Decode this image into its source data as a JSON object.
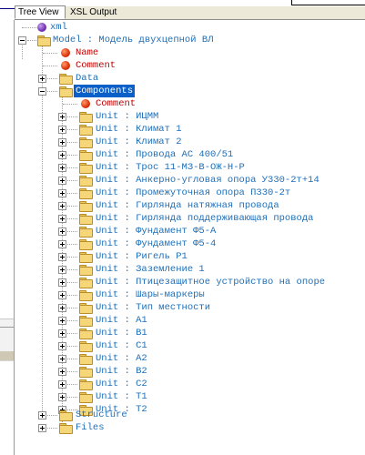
{
  "tabs": [
    {
      "label": "Tree View",
      "active": true
    },
    {
      "label": "XSL Output",
      "active": false
    }
  ],
  "tree": {
    "root": {
      "label": "xml"
    },
    "model": {
      "label": "Model : Модель двухцепной ВЛ"
    },
    "model_name": {
      "label": "Name"
    },
    "model_comment": {
      "label": "Comment"
    },
    "data": {
      "label": "Data"
    },
    "components": {
      "label": "Components"
    },
    "components_comment": {
      "label": "Comment"
    },
    "units": [
      "Unit : ИЦММ",
      "Unit : Климат 1",
      "Unit : Климат 2",
      "Unit : Провода АС 400/51",
      "Unit : Трос 11-МЗ-В-ОЖ-Н-Р",
      "Unit : Анкерно-угловая опора У330-2т+14",
      "Unit : Промежуточная опора П330-2т",
      "Unit : Гирлянда натяжная провода",
      "Unit : Гирлянда поддерживающая провода",
      "Unit : Фундамент Ф5-А",
      "Unit : Фундамент Ф5-4",
      "Unit : Ригель Р1",
      "Unit : Заземление 1",
      "Unit : Птицезащитное устройство на опоре",
      "Unit : Шары-маркеры",
      "Unit : Тип местности",
      "Unit : А1",
      "Unit : В1",
      "Unit : С1",
      "Unit : А2",
      "Unit : В2",
      "Unit : С2",
      "Unit : Т1",
      "Unit : Т2"
    ],
    "structure": {
      "label": "Structure"
    },
    "files": {
      "label": "Files"
    }
  },
  "colors": {
    "node_text": "#1f6fb8",
    "attr_text": "#c00000",
    "selection": "#0a5fc8",
    "folder": "#f5d77a"
  },
  "icons": {
    "folder": "folder-icon",
    "attribute": "attribute-dot-icon",
    "document": "xml-document-icon"
  }
}
